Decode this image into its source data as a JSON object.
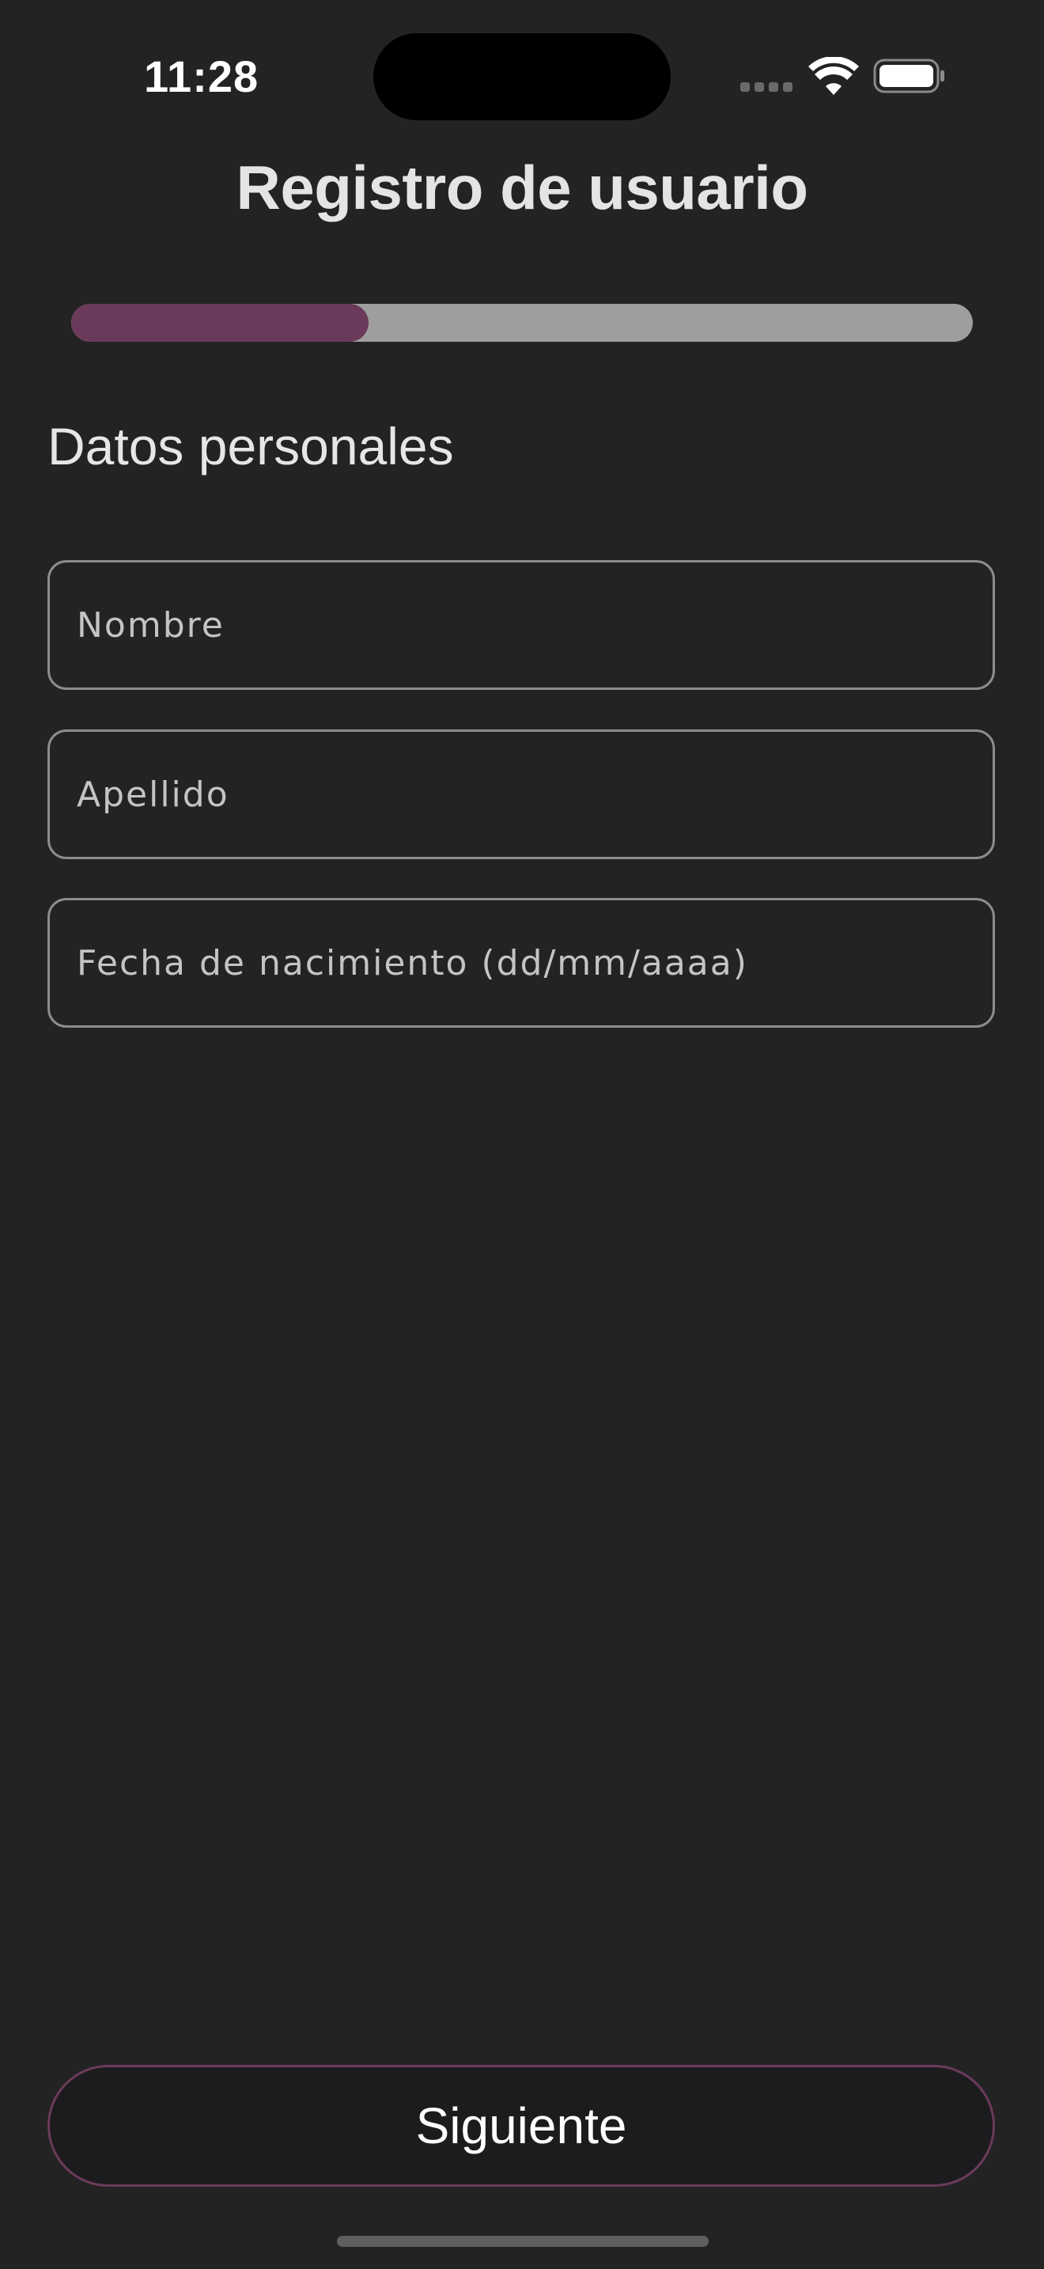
{
  "status_bar": {
    "time": "11:28",
    "icons": [
      "cellular-signal-icon",
      "wifi-icon",
      "battery-icon"
    ]
  },
  "header": {
    "title": "Registro de usuario"
  },
  "progress": {
    "value": 0.33
  },
  "section": {
    "title": "Datos personales"
  },
  "form": {
    "first_name": {
      "placeholder": "Nombre",
      "value": ""
    },
    "last_name": {
      "placeholder": "Apellido",
      "value": ""
    },
    "birth_date": {
      "placeholder": "Fecha de nacimiento (dd/mm/aaaa)",
      "value": ""
    }
  },
  "actions": {
    "next_label": "Siguiente"
  },
  "colors": {
    "background": "#232323",
    "accent": "#6b3a5b",
    "progress_track": "#9e9e9e",
    "field_border": "#8d8d8d",
    "button_background": "#1c1c1e"
  }
}
